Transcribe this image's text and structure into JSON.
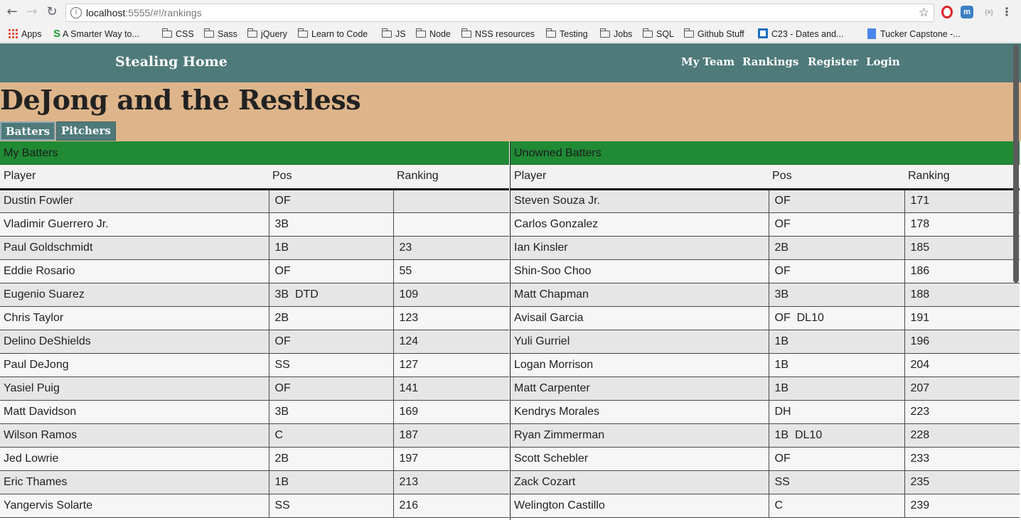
{
  "browser": {
    "url_host": "localhost",
    "url_rest": ":5555/#!/rankings",
    "bookmarks": [
      {
        "label": "Apps",
        "icon": "apps-icon"
      },
      {
        "label": "A Smarter Way to...",
        "icon": "s-icon"
      },
      {
        "label": "CSS",
        "icon": "folder-icon"
      },
      {
        "label": "Sass",
        "icon": "folder-icon"
      },
      {
        "label": "jQuery",
        "icon": "folder-icon"
      },
      {
        "label": "Learn to Code",
        "icon": "folder-icon"
      },
      {
        "label": "JS",
        "icon": "folder-icon"
      },
      {
        "label": "Node",
        "icon": "folder-icon"
      },
      {
        "label": "NSS resources",
        "icon": "folder-icon"
      },
      {
        "label": "Testing",
        "icon": "folder-icon"
      },
      {
        "label": "Jobs",
        "icon": "folder-icon"
      },
      {
        "label": "SQL",
        "icon": "folder-icon"
      },
      {
        "label": "Github Stuff",
        "icon": "folder-icon"
      },
      {
        "label": "C23 - Dates and...",
        "icon": "c23-icon"
      },
      {
        "label": "Tucker Capstone -...",
        "icon": "doc-icon"
      }
    ],
    "ext_json_label": "{≡}"
  },
  "navbar": {
    "brand": "Stealing Home",
    "links": [
      "My Team",
      "Rankings",
      "Register",
      "Login"
    ]
  },
  "team": {
    "name": "DeJong and the Restless",
    "tabs": [
      "Batters",
      "Pitchers"
    ]
  },
  "my_batters": {
    "title": "My Batters",
    "columns": [
      "Player",
      "Pos",
      "Ranking"
    ],
    "rows": [
      [
        "Dustin Fowler",
        "OF",
        ""
      ],
      [
        "Vladimir Guerrero Jr.",
        "3B",
        ""
      ],
      [
        "Paul Goldschmidt",
        "1B",
        "23"
      ],
      [
        "Eddie Rosario",
        "OF",
        "55"
      ],
      [
        "Eugenio Suarez",
        "3B  DTD",
        "109"
      ],
      [
        "Chris Taylor",
        "2B",
        "123"
      ],
      [
        "Delino DeShields",
        "OF",
        "124"
      ],
      [
        "Paul DeJong",
        "SS",
        "127"
      ],
      [
        "Yasiel Puig",
        "OF",
        "141"
      ],
      [
        "Matt Davidson",
        "3B",
        "169"
      ],
      [
        "Wilson Ramos",
        "C",
        "187"
      ],
      [
        "Jed Lowrie",
        "2B",
        "197"
      ],
      [
        "Eric Thames",
        "1B",
        "213"
      ],
      [
        "Yangervis Solarte",
        "SS",
        "216"
      ]
    ]
  },
  "unowned_batters": {
    "title": "Unowned Batters",
    "columns": [
      "Player",
      "Pos",
      "Ranking"
    ],
    "rows": [
      [
        "Steven Souza Jr.",
        "OF",
        "171"
      ],
      [
        "Carlos Gonzalez",
        "OF",
        "178"
      ],
      [
        "Ian Kinsler",
        "2B",
        "185"
      ],
      [
        "Shin-Soo Choo",
        "OF",
        "186"
      ],
      [
        "Matt Chapman",
        "3B",
        "188"
      ],
      [
        "Avisail Garcia",
        "OF  DL10",
        "191"
      ],
      [
        "Yuli Gurriel",
        "1B",
        "196"
      ],
      [
        "Logan Morrison",
        "1B",
        "204"
      ],
      [
        "Matt Carpenter",
        "1B",
        "207"
      ],
      [
        "Kendrys Morales",
        "DH",
        "223"
      ],
      [
        "Ryan Zimmerman",
        "1B  DL10",
        "228"
      ],
      [
        "Scott Schebler",
        "OF",
        "233"
      ],
      [
        "Zack Cozart",
        "SS",
        "235"
      ],
      [
        "Welington Castillo",
        "C",
        "239"
      ]
    ]
  }
}
